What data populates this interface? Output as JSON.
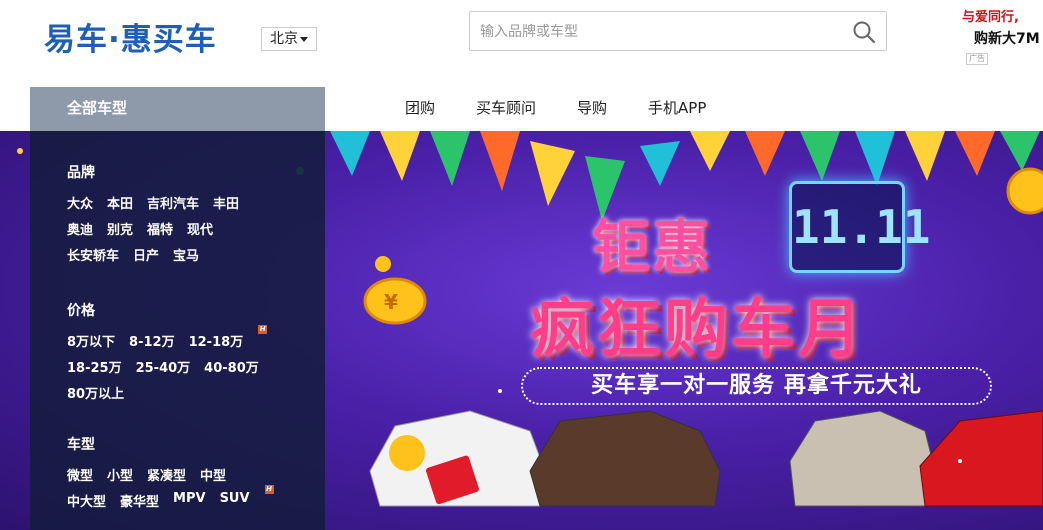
{
  "header": {
    "logo": "易车·惠买车",
    "city": "北京",
    "search_placeholder": "输入品牌或车型"
  },
  "ad": {
    "line1": "与爱同行,",
    "line2": "购新大7M",
    "tag": "广告"
  },
  "nav": {
    "all_models": "全部车型",
    "links": [
      "团购",
      "买车顾问",
      "导购",
      "手机APP"
    ]
  },
  "sidemenu": {
    "brand": {
      "title": "品牌",
      "items": [
        "大众",
        "本田",
        "吉利汽车",
        "丰田",
        "奥迪",
        "别克",
        "福特",
        "现代",
        "长安轿车",
        "日产",
        "宝马"
      ]
    },
    "price": {
      "title": "价格",
      "items": [
        "8万以下",
        "8-12万",
        "12-18万",
        "18-25万",
        "25-40万",
        "40-80万",
        "80万以上"
      ],
      "hot_badge": "H"
    },
    "type": {
      "title": "车型",
      "items": [
        "微型",
        "小型",
        "紧凑型",
        "中型",
        "中大型",
        "豪华型",
        "MPV",
        "SUV"
      ],
      "hot_badge": "H"
    }
  },
  "banner": {
    "headline1": "钜惠",
    "date_badge": "11.11",
    "headline2": "疯狂购车月",
    "slogan": "买车享一对一服务 再拿千元大礼",
    "colors": {
      "bg": "#4a20a8",
      "accent": "#ff3e8a",
      "neon": "#7ad3ff"
    }
  },
  "colors": {
    "brand_blue": "#1f5fb3",
    "nav_bg": "#8e99aa",
    "ad_red": "#c4161c"
  }
}
